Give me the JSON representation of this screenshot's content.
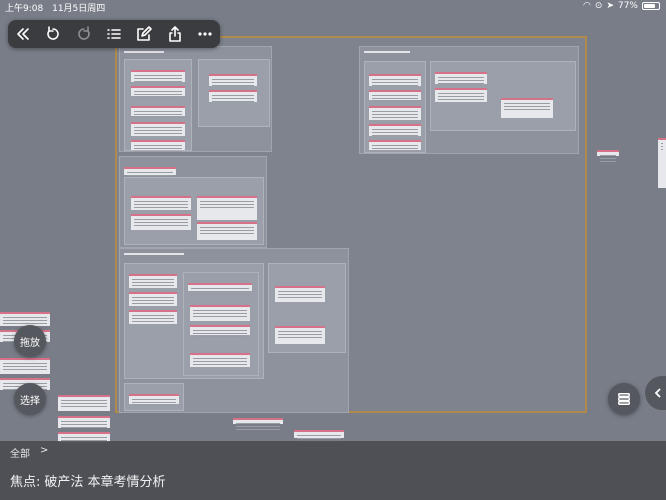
{
  "status": {
    "time": "上午9:08",
    "date": "11月5日周四",
    "battery": "77%",
    "battery_level": 0.77,
    "icons": [
      "wifi-icon",
      "lock-rotation-icon",
      "location-icon",
      "battery-icon"
    ]
  },
  "toolbar": {
    "buttons": [
      "collapse-left-icon",
      "undo-icon",
      "redo-icon",
      "outline-list-icon",
      "edit-icon",
      "share-icon",
      "more-icon"
    ]
  },
  "canvas": {
    "float_buttons": {
      "drag": "拖放",
      "select": "选择"
    },
    "fab_icon": "stack-icon",
    "side_tab_icon": "chevron-left-icon"
  },
  "bottom": {
    "breadcrumb": {
      "root": "全部",
      "separator": ">"
    },
    "focus": {
      "prefix": "焦点:",
      "topic": "破产法 本章考情分析"
    }
  },
  "colors": {
    "canvas_bg": "#787d87",
    "frame_border": "#b08a4c",
    "card_accent": "#d6718a",
    "toolbar_bg": "#3b3c40"
  }
}
